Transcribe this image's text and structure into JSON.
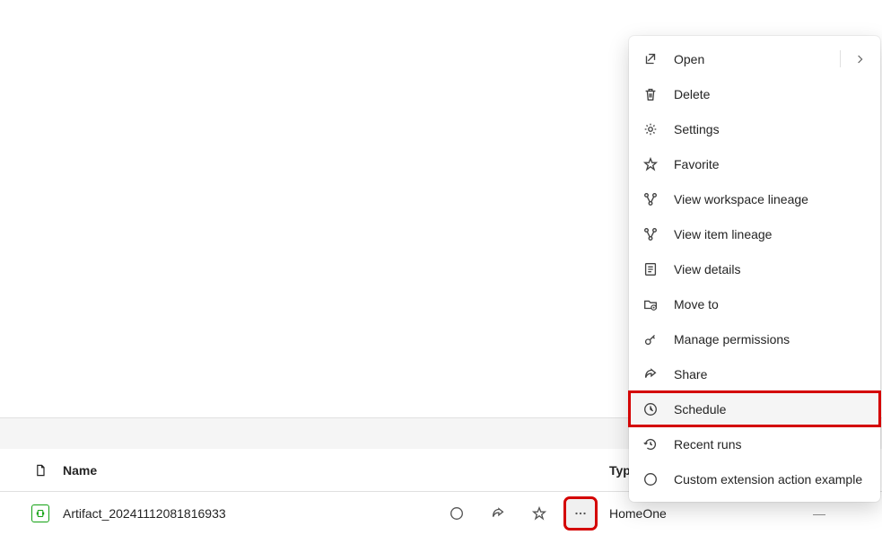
{
  "table": {
    "headers": {
      "name": "Name",
      "type": "Type"
    },
    "row": {
      "name": "Artifact_20241112081816933",
      "type": "HomeOne",
      "endCol": "—"
    }
  },
  "menu": {
    "items": [
      {
        "key": "open",
        "label": "Open",
        "hasSubmenu": true,
        "hasDivider": true
      },
      {
        "key": "delete",
        "label": "Delete"
      },
      {
        "key": "settings",
        "label": "Settings"
      },
      {
        "key": "favorite",
        "label": "Favorite"
      },
      {
        "key": "workspace-lineage",
        "label": "View workspace lineage"
      },
      {
        "key": "item-lineage",
        "label": "View item lineage"
      },
      {
        "key": "view-details",
        "label": "View details"
      },
      {
        "key": "move-to",
        "label": "Move to"
      },
      {
        "key": "manage-permissions",
        "label": "Manage permissions"
      },
      {
        "key": "share",
        "label": "Share"
      },
      {
        "key": "schedule",
        "label": "Schedule",
        "highlighted": true
      },
      {
        "key": "recent-runs",
        "label": "Recent runs"
      },
      {
        "key": "custom-ext",
        "label": "Custom extension action example"
      }
    ]
  },
  "icons": {
    "open": "open-icon",
    "delete": "trash-icon",
    "settings": "gear-icon",
    "favorite": "star-icon",
    "workspace-lineage": "lineage-icon",
    "item-lineage": "lineage-icon",
    "view-details": "details-icon",
    "move-to": "folder-arrow-icon",
    "manage-permissions": "key-icon",
    "share": "share-icon",
    "schedule": "clock-icon",
    "recent-runs": "history-icon",
    "custom-ext": "circle-icon"
  }
}
